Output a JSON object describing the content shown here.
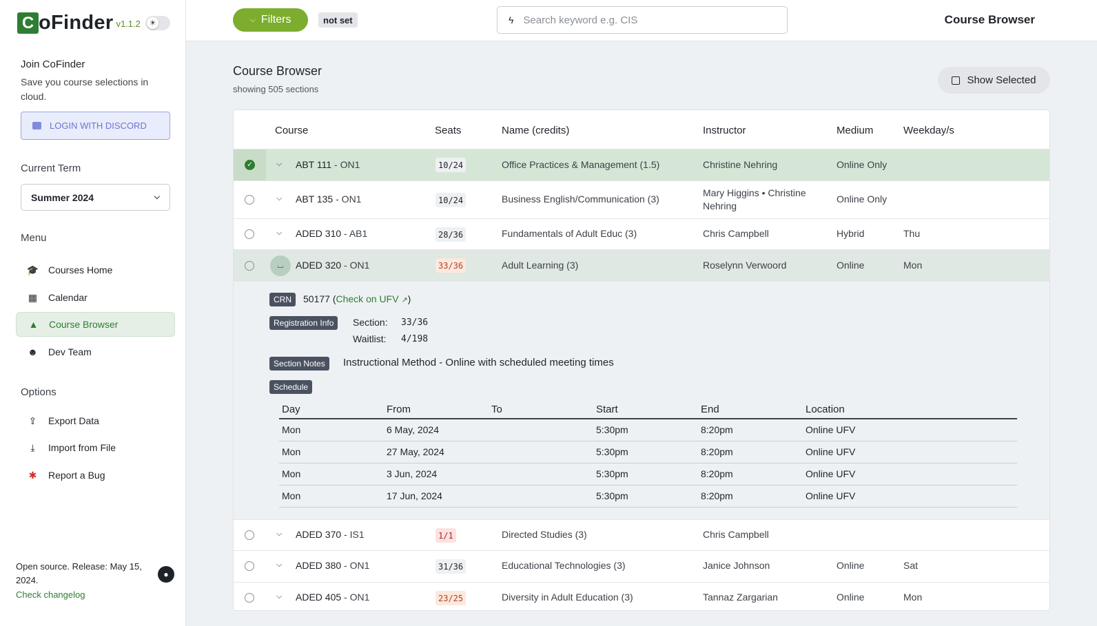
{
  "app": {
    "name_initial": "C",
    "name_rest": "oFinder",
    "version": "v1.1.2"
  },
  "sidebar": {
    "join_title": "Join CoFinder",
    "join_text": "Save you course selections in cloud.",
    "login_label": "LOGIN WITH DISCORD",
    "term_label": "Current Term",
    "term_value": "Summer 2024",
    "menu_label": "Menu",
    "menu": [
      {
        "label": "Courses Home",
        "icon": "graduation-cap-icon"
      },
      {
        "label": "Calendar",
        "icon": "calendar-icon"
      },
      {
        "label": "Course Browser",
        "icon": "shapes-icon",
        "active": true
      },
      {
        "label": "Dev Team",
        "icon": "smiley-icon"
      }
    ],
    "options_label": "Options",
    "options": [
      {
        "label": "Export Data",
        "icon": "export-icon"
      },
      {
        "label": "Import from File",
        "icon": "import-icon"
      },
      {
        "label": "Report a Bug",
        "icon": "bug-icon"
      }
    ],
    "footer_text": "Open source. Release: May 15, 2024.",
    "footer_link": "Check changelog"
  },
  "topbar": {
    "filters_label": "Filters",
    "filter_status": "not set",
    "search_placeholder": "Search keyword e.g. CIS",
    "page_title": "Course Browser"
  },
  "main": {
    "title": "Course Browser",
    "subtitle": "showing 505 sections",
    "show_selected": "Show Selected"
  },
  "table": {
    "headers": [
      "Course",
      "Seats",
      "Name (credits)",
      "Instructor",
      "Medium",
      "Weekday/s"
    ],
    "rows": [
      {
        "code": "ABT 111",
        "section": " - ON1",
        "seats": "10/24",
        "name": "Office Practices & Management (1.5)",
        "instructor": "Christine Nehring",
        "medium": "Online Only",
        "days": ""
      },
      {
        "code": "ABT 135",
        "section": " - ON1",
        "seats": "10/24",
        "name": "Business English/Communication (3)",
        "instructor": "Mary Higgins • Christine Nehring",
        "medium": "Online Only",
        "days": ""
      },
      {
        "code": "ADED 310",
        "section": " - AB1",
        "seats": "28/36",
        "name": "Fundamentals of Adult Educ (3)",
        "instructor": "Chris Campbell",
        "medium": "Hybrid",
        "days": "Thu"
      },
      {
        "code": "ADED 320",
        "section": " - ON1",
        "seats": "33/36",
        "name": "Adult Learning (3)",
        "instructor": "Roselynn Verwoord",
        "medium": "Online",
        "days": "Mon"
      },
      {
        "code": "ADED 370",
        "section": " - IS1",
        "seats": "1/1",
        "name": "Directed Studies (3)",
        "instructor": "Chris Campbell",
        "medium": "",
        "days": ""
      },
      {
        "code": "ADED 380",
        "section": " - ON1",
        "seats": "31/36",
        "name": "Educational Technologies (3)",
        "instructor": "Janice Johnson",
        "medium": "Online",
        "days": "Sat"
      },
      {
        "code": "ADED 405",
        "section": " - ON1",
        "seats": "23/25",
        "name": "Diversity in Adult Education (3)",
        "instructor": "Tannaz Zargarian",
        "medium": "Online",
        "days": "Mon"
      }
    ]
  },
  "detail": {
    "crn_tag": "CRN",
    "crn": "50177",
    "check_link": "Check on UFV",
    "reg_tag": "Registration Info",
    "section_label": "Section:",
    "section_value": "33/36",
    "waitlist_label": "Waitlist:",
    "waitlist_value": "4/198",
    "notes_tag": "Section Notes",
    "notes": "Instructional Method - Online with scheduled meeting times",
    "schedule_tag": "Schedule",
    "schedule_headers": [
      "Day",
      "From",
      "To",
      "Start",
      "End",
      "Location"
    ],
    "schedule": [
      [
        "Mon",
        "6 May, 2024",
        "",
        "5:30pm",
        "8:20pm",
        "Online UFV"
      ],
      [
        "Mon",
        "27 May, 2024",
        "",
        "5:30pm",
        "8:20pm",
        "Online UFV"
      ],
      [
        "Mon",
        "3 Jun, 2024",
        "",
        "5:30pm",
        "8:20pm",
        "Online UFV"
      ],
      [
        "Mon",
        "17 Jun, 2024",
        "",
        "5:30pm",
        "8:20pm",
        "Online UFV"
      ]
    ]
  }
}
